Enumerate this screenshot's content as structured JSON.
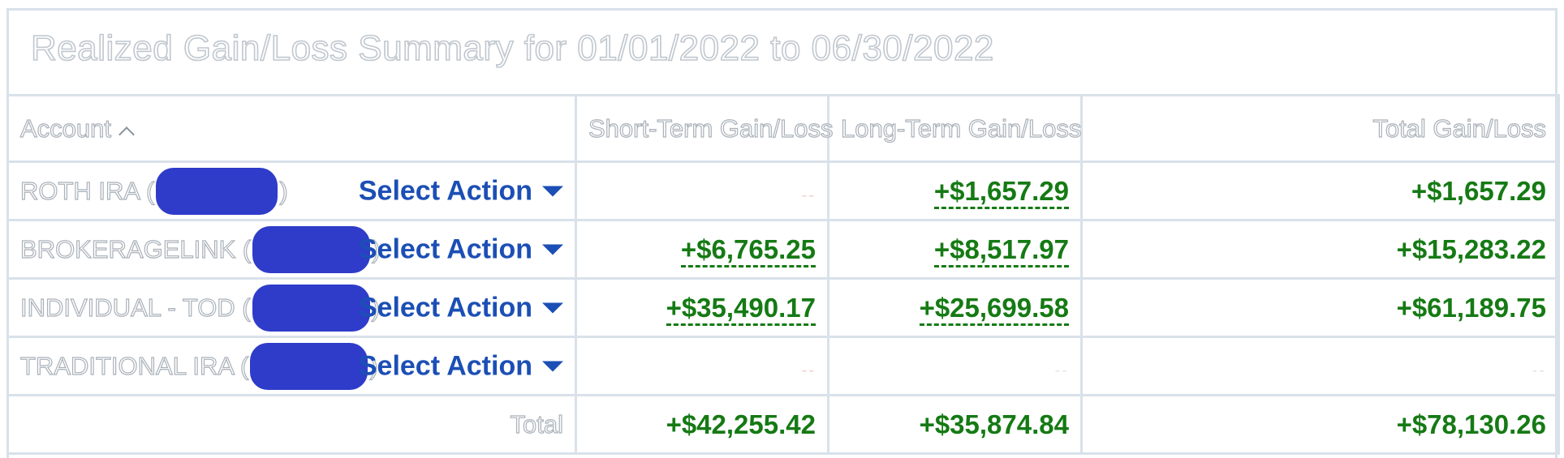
{
  "title": "Realized Gain/Loss Summary for 01/01/2022 to 06/30/2022",
  "columns": {
    "account": "Account",
    "short_term": "Short-Term Gain/Loss",
    "long_term": "Long-Term Gain/Loss",
    "total": "Total Gain/Loss"
  },
  "rows": [
    {
      "account": "ROTH IRA (",
      "close": ")",
      "action": "Select Action",
      "short_term": "--",
      "long_term": "+$1,657.29",
      "total": "+$1,657.29"
    },
    {
      "account": "BROKERAGELINK (",
      "close": ")",
      "action": "Select Action",
      "short_term": "+$6,765.25",
      "long_term": "+$8,517.97",
      "total": "+$15,283.22"
    },
    {
      "account": "INDIVIDUAL - TOD (",
      "close": ")",
      "action": "Select Action",
      "short_term": "+$35,490.17",
      "long_term": "+$25,699.58",
      "total": "+$61,189.75"
    },
    {
      "account": "TRADITIONAL IRA (",
      "close": ")",
      "action": "Select Action",
      "short_term": "--",
      "long_term": "--",
      "total": "--"
    }
  ],
  "totals": {
    "label": "Total",
    "short_term": "+$42,255.42",
    "long_term": "+$35,874.84",
    "total": "+$78,130.26"
  },
  "colors": {
    "gain_green": "#157a14",
    "action_blue": "#1c4fb5",
    "redaction": "#2f3cc9",
    "border": "#d9e1ea"
  },
  "icons": {
    "sort": "chevron-up-icon",
    "action_menu": "caret-down-icon"
  }
}
